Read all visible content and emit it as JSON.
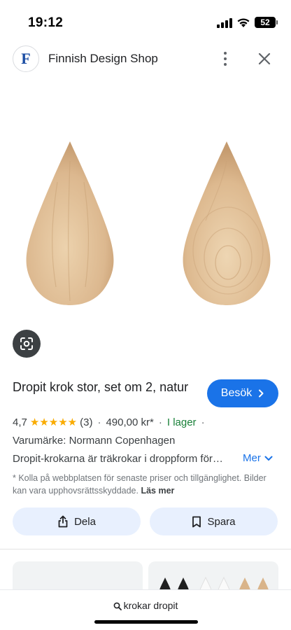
{
  "status_bar": {
    "time": "19:12",
    "battery": "52"
  },
  "header": {
    "site_name": "Finnish Design Shop",
    "favicon_letter": "F"
  },
  "product": {
    "title": "Dropit krok stor, set om 2, natur",
    "visit_label": "Besök",
    "rating": "4,7",
    "stars": 4.7,
    "review_count": "(3)",
    "price": "490,00 kr*",
    "stock": "I lager",
    "brand": "Varumärke: Normann Copenhagen",
    "description": "Dropit-krokarna är träkrokar i droppform för…",
    "more_label": "Mer",
    "disclaimer": "* Kolla på webbplatsen för senaste priser och tillgänglighet. Bilder kan vara upphovsrättsskyddade.",
    "read_more": "Läs mer"
  },
  "actions": {
    "share": "Dela",
    "save": "Spara"
  },
  "search": {
    "query": "krokar dropit"
  },
  "colors": {
    "accent": "#1a73e8",
    "star": "#f9ab00",
    "in_stock": "#188038",
    "action_bg": "#e8f0fe",
    "wood": "#dcb88f"
  },
  "icons": [
    "signal-icon",
    "wifi-icon",
    "battery-icon",
    "more-vert-icon",
    "close-icon",
    "lens-icon",
    "chevron-right-icon",
    "chevron-down-icon",
    "share-icon",
    "bookmark-icon",
    "search-icon"
  ]
}
